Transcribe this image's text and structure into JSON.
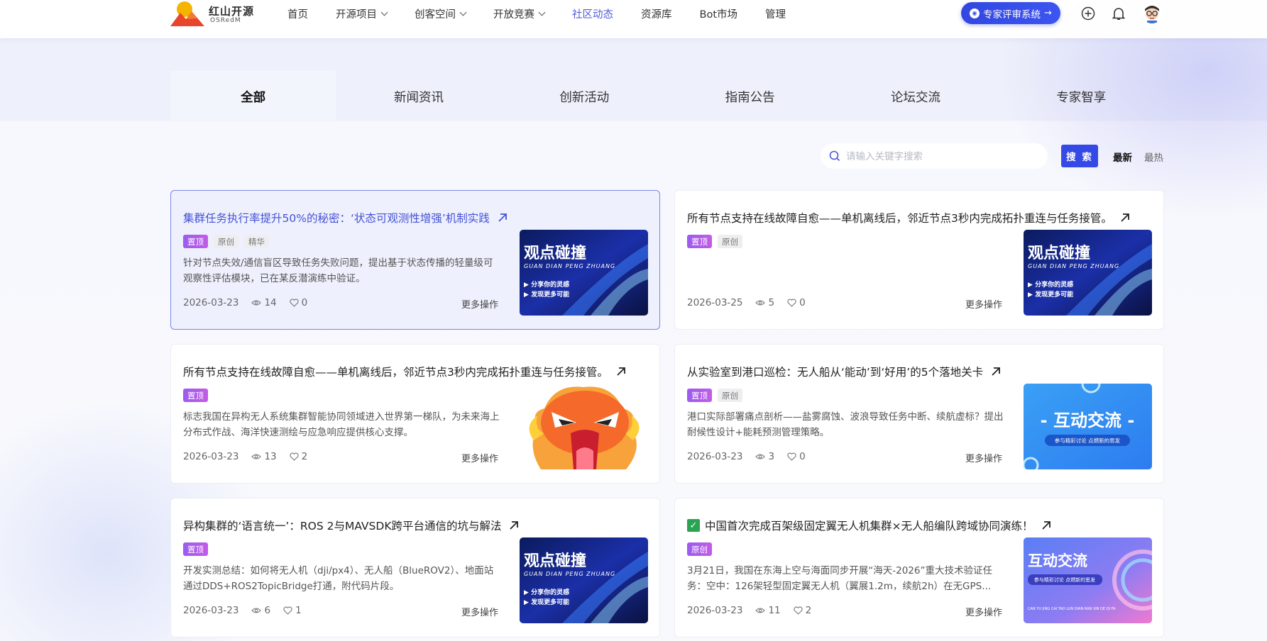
{
  "brand": {
    "title": "红山开源",
    "subtitle": "OSRedM"
  },
  "nav": [
    {
      "label": "首页"
    },
    {
      "label": "开源项目",
      "dropdown": true
    },
    {
      "label": "创客空间",
      "dropdown": true
    },
    {
      "label": "开放竞赛",
      "dropdown": true
    },
    {
      "label": "社区动态",
      "active": true
    },
    {
      "label": "资源库"
    },
    {
      "label": "Bot市场"
    },
    {
      "label": "管理"
    }
  ],
  "header": {
    "expert_label": "专家评审系统"
  },
  "tabs": [
    "全部",
    "新闻资讯",
    "创新活动",
    "指南公告",
    "论坛交流",
    "专家智享"
  ],
  "search": {
    "placeholder": "请输入关键字搜索",
    "button": "搜 索",
    "sort_latest": "最新",
    "sort_hot": "最热"
  },
  "more_ops": "更多操作",
  "thumb_texts": {
    "viewpoint_title": "观点碰撞",
    "viewpoint_pinyin": "GUAN DIAN PENG ZHUANG",
    "viewpoint_line1": "分享你的灵感",
    "viewpoint_line2": "发现更多可能",
    "interact_title": "- 互动交流 -",
    "interact_sub": "参与精彩讨论 点燃新的思发",
    "interact2_title": "互动交流",
    "interact2_sub": "参与精彩讨论 点燃新的思发",
    "interact2_pinyin": "CAN YU JING CAI TAO LUN DIAN RAN XIN DE QI FA"
  },
  "cards": [
    {
      "title": "集群任务执行率提升50%的秘密：‘状态可观测性增强’机制实践",
      "tags": [
        "置顶",
        "原创",
        "精华"
      ],
      "desc": "针对节点失效/通信盲区导致任务失败问题，提出基于状态传播的轻量级可观察性评估模块，已在某反潜演练中验证。",
      "date": "2026-03-23",
      "views": "14",
      "likes": "0"
    },
    {
      "title": "所有节点支持在线故障自愈——单机离线后，邻近节点3秒内完成拓扑重连与任务接管。",
      "tags": [
        "置顶",
        "原创"
      ],
      "desc": "",
      "date": "2026-03-25",
      "views": "5",
      "likes": "0"
    },
    {
      "title": "所有节点支持在线故障自愈——单机离线后，邻近节点3秒内完成拓扑重连与任务接管。",
      "tags": [
        "置顶"
      ],
      "desc": "标志我国在异构无人系统集群智能协同领域进入世界第一梯队，为未来海上分布式作战、海洋快速测绘与应急响应提供核心支撑。",
      "date": "2026-03-23",
      "views": "13",
      "likes": "2"
    },
    {
      "title": "从实验室到港口巡检：无人船从‘能动’到‘好用’的5个落地关卡",
      "tags": [
        "置顶",
        "原创"
      ],
      "desc": "港口实际部署痛点剖析——盐雾腐蚀、波浪导致任务中断、续航虚标？提出耐候性设计+能耗预测管理策略。",
      "date": "2026-03-23",
      "views": "3",
      "likes": "0"
    },
    {
      "title": "异构集群的‘语言统一’：ROS 2与MAVSDK跨平台通信的坑与解法",
      "tags": [
        "置顶"
      ],
      "desc": "开发实测总结：如何将无人机（dji/px4）、无人船（BlueROV2）、地面站通过DDS+ROS2TopicBridge打通，附代码片段。",
      "date": "2026-03-23",
      "views": "6",
      "likes": "1"
    },
    {
      "title": "中国首次完成百架级固定翼无人机集群×无人船编队跨域协同演练！",
      "check": "✓",
      "tags": [
        "原创"
      ],
      "desc": "3月21日，我国在东海上空与海面同步开展“海天-2026”重大技术验证任务：空中：126架轻型固定翼无人机（翼展1.2m，续航2h）在无GPS...",
      "date": "2026-03-23",
      "views": "11",
      "likes": "2"
    }
  ],
  "colors": {
    "accent": "#4e5ad8",
    "button": "#3549e6",
    "pin_tag": "#a45bee"
  }
}
